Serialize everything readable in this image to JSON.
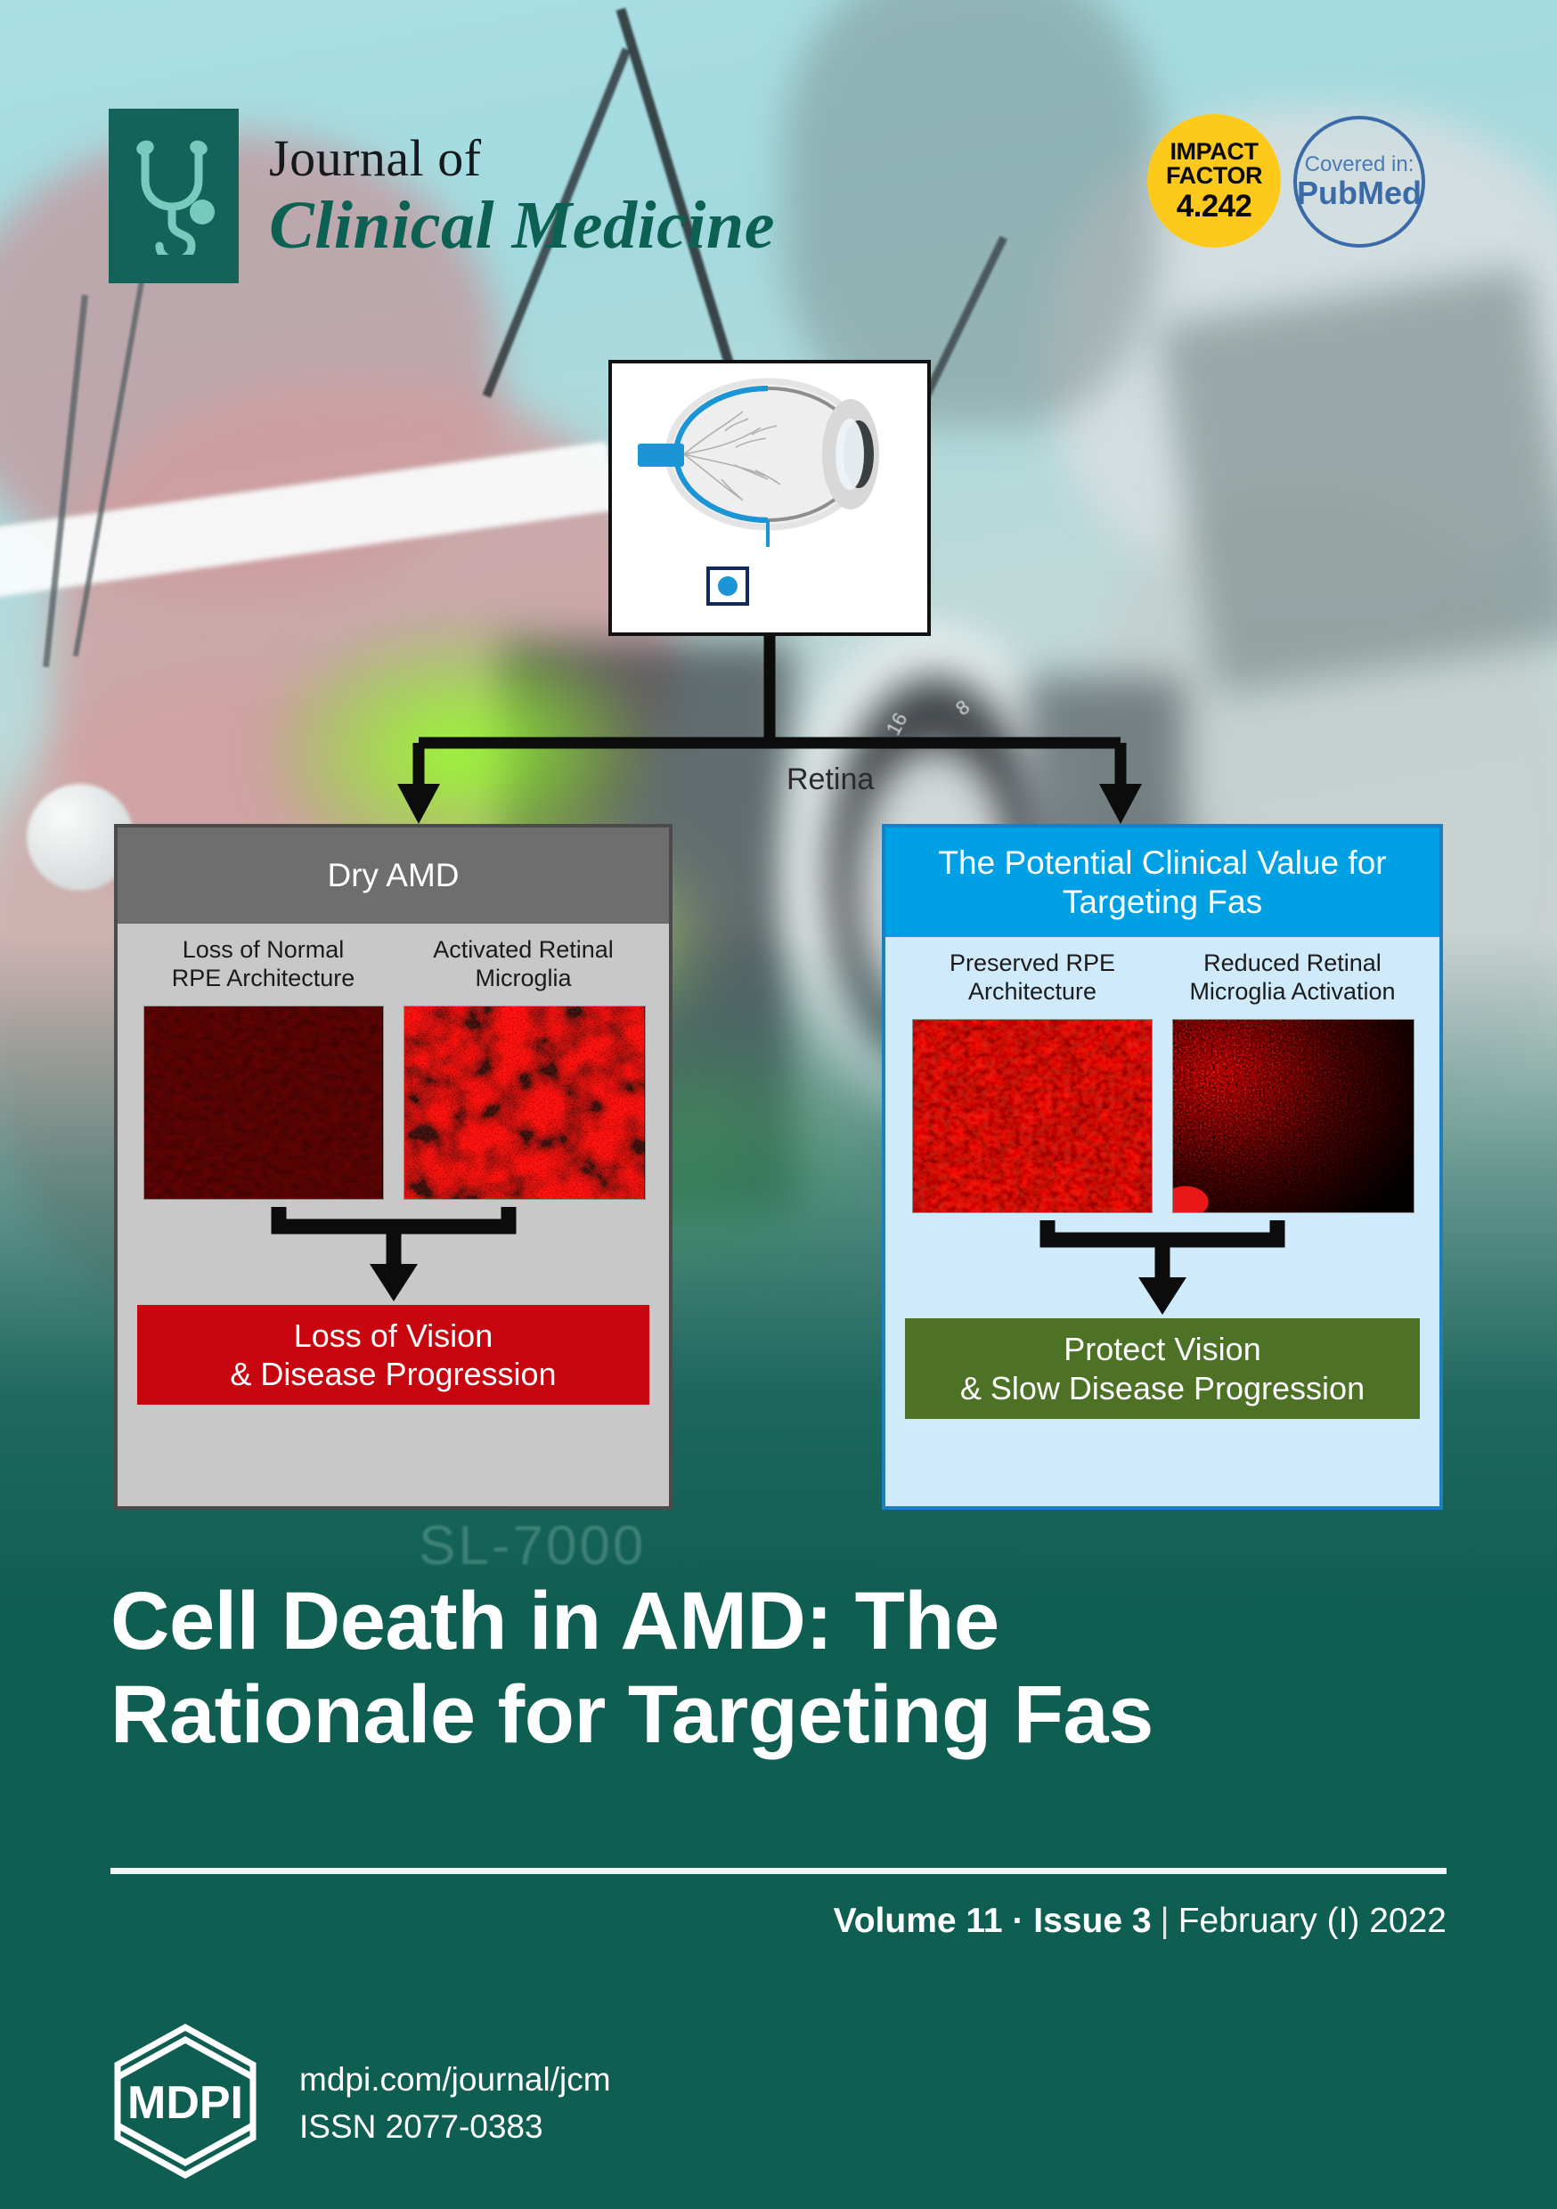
{
  "journal": {
    "logo_icon": "stethoscope-icon",
    "title_line1": "Journal of",
    "title_line2": "Clinical Medicine",
    "brand_color": "#0c6152",
    "logo_bg": "#13635a"
  },
  "badges": {
    "impact_factor": {
      "line1": "IMPACT",
      "line2": "FACTOR",
      "value": "4.242",
      "color": "#fdc91b"
    },
    "indexed": {
      "label": "Covered in:",
      "database": "PubMed",
      "color": "#3a6aa8"
    }
  },
  "graphical_abstract": {
    "eye_diagram": {
      "label": "Retina",
      "accent_color": "#1b95d6"
    },
    "panels": [
      {
        "id": "dry-amd",
        "header": "Dry AMD",
        "header_color": "#6e6e6e",
        "body_color": "#c8c8c8",
        "border_color": "#4b4b4b",
        "images": [
          {
            "caption_line1": "Loss of Normal",
            "caption_line2": "RPE Architecture",
            "intensity": "low"
          },
          {
            "caption_line1": "Activated Retinal",
            "caption_line2": "Microglia",
            "intensity": "medium"
          }
        ],
        "outcome_line1": "Loss of Vision",
        "outcome_line2": "& Disease Progression",
        "outcome_color": "#c70610"
      },
      {
        "id": "targeting-fas",
        "header_line1": "The Potential Clinical Value for",
        "header_line2": "Targeting Fas",
        "header_color": "#00a0e4",
        "body_color": "#cfeafb",
        "border_color": "#1b7fc4",
        "images": [
          {
            "caption_line1": "Preserved RPE",
            "caption_line2": "Architecture",
            "intensity": "high"
          },
          {
            "caption_line1": "Reduced Retinal",
            "caption_line2": "Microglia Activation",
            "intensity": "low-medium"
          }
        ],
        "outcome_line1": "Protect Vision",
        "outcome_line2": "& Slow Disease Progression",
        "outcome_color": "#4d7226"
      }
    ]
  },
  "background": {
    "watermark_text": "SL-7000"
  },
  "cover_title": {
    "line1": "Cell Death in AMD: The",
    "line2": "Rationale for Targeting Fas"
  },
  "issue": {
    "volume": "Volume 11 · Issue 3",
    "separator": "|",
    "date": "February (I) 2022"
  },
  "footer": {
    "publisher_icon": "mdpi-logo",
    "publisher": "MDPI",
    "url": "mdpi.com/journal/jcm",
    "issn": "ISSN 2077-0383"
  }
}
